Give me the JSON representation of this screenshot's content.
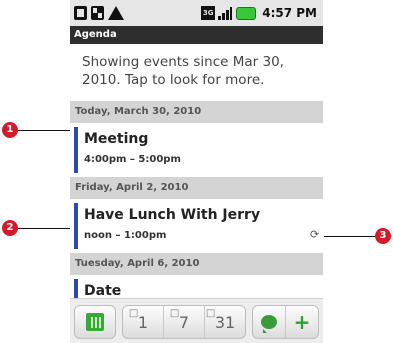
{
  "status_bar": {
    "left_icons": [
      "sd-card-icon",
      "sd-card-mounted-icon",
      "warning-icon"
    ],
    "right_icons": [
      "3g-icon",
      "signal-icon",
      "battery-icon"
    ],
    "network_label": "3G",
    "time": "4:57 PM"
  },
  "app": {
    "title": "Agenda"
  },
  "notice": "Showing events since Mar 30, 2010. Tap to look for more.",
  "days": [
    {
      "header": "Today, March 30, 2010",
      "events": [
        {
          "title": "Meeting",
          "time": "4:00pm – 5:00pm",
          "repeating": false
        }
      ]
    },
    {
      "header": "Friday, April 2, 2010",
      "events": [
        {
          "title": "Have Lunch With Jerry",
          "time": "noon – 1:00pm",
          "repeating": true
        }
      ]
    },
    {
      "header": "Tuesday, April 6, 2010",
      "events": [
        {
          "title": "Date",
          "time": "",
          "repeating": false
        }
      ]
    }
  ],
  "toolbar": {
    "agenda_icon": "calendar-grid-icon",
    "day_label": "1",
    "week_label": "7",
    "month_label": "31",
    "chat_icon": "speech-bubble-icon",
    "new_event_label": "+"
  },
  "callouts": [
    "1",
    "2",
    "3"
  ],
  "colors": {
    "event_bar": "#2d4aa8",
    "title_bar": "#2e2e2e",
    "date_header": "#d4d4d4",
    "callout": "#d31a2a",
    "accent_green": "#3aa835"
  }
}
